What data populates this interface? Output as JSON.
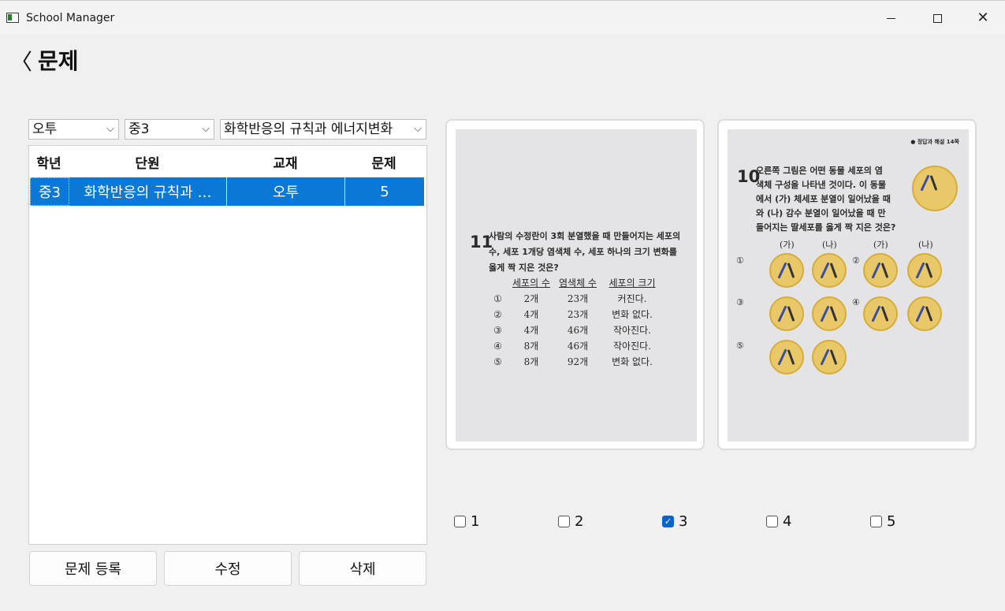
{
  "window": {
    "title": "School Manager",
    "close_glyph": "✕"
  },
  "header": {
    "back_glyph": "〈",
    "title": "문제"
  },
  "filters": {
    "type": "오투",
    "grade": "중3",
    "unit": "화학반응의 규칙과 에너지변화",
    "chevron": "⌵"
  },
  "table": {
    "columns": [
      "학년",
      "단원",
      "교재",
      "문제"
    ],
    "rows": [
      {
        "grade": "중3",
        "unit": "화학반응의 규칙과 …",
        "book": "오투",
        "problem": "5",
        "selected": true
      }
    ]
  },
  "buttons": {
    "register": "문제 등록",
    "edit": "수정",
    "delete": "삭제"
  },
  "images": {
    "left": {
      "number": "11",
      "question": [
        "사람의 수정란이 3회 분열했을 때 만들어지는 세포의",
        "수, 세포 1개당 염색체 수, 세포 하나의 크기 변화를",
        "옳게 짝 지은 것은?"
      ],
      "headers": [
        "",
        "세포의 수",
        "염색체 수",
        "세포의 크기"
      ],
      "rows": [
        [
          "①",
          "2개",
          "23개",
          "커진다."
        ],
        [
          "②",
          "4개",
          "23개",
          "변화 없다."
        ],
        [
          "③",
          "4개",
          "46개",
          "작아진다."
        ],
        [
          "④",
          "8개",
          "46개",
          "작아진다."
        ],
        [
          "⑤",
          "8개",
          "92개",
          "변화 없다."
        ]
      ]
    },
    "right": {
      "note": "● 정답과 해설 14쪽",
      "number": "10",
      "question": [
        "오른쪽 그림은 어떤 동물 세포의 염",
        "색체 구성을 나타낸 것이다. 이 동물",
        "에서 (가) 체세포 분열이 일어났을 때",
        "와 (나) 감수 분열이 일어났을 때 만",
        "들어지는 딸세포를 옳게 짝 지은 것은?"
      ],
      "labels": [
        "(가)",
        "(나)",
        "(가)",
        "(나)"
      ],
      "choices": [
        "①",
        "②",
        "③",
        "④",
        "⑤"
      ]
    }
  },
  "answers": {
    "options": [
      {
        "label": "1",
        "checked": false
      },
      {
        "label": "2",
        "checked": false
      },
      {
        "label": "3",
        "checked": true
      },
      {
        "label": "4",
        "checked": false
      },
      {
        "label": "5",
        "checked": false
      }
    ],
    "check_glyph": "✓"
  }
}
